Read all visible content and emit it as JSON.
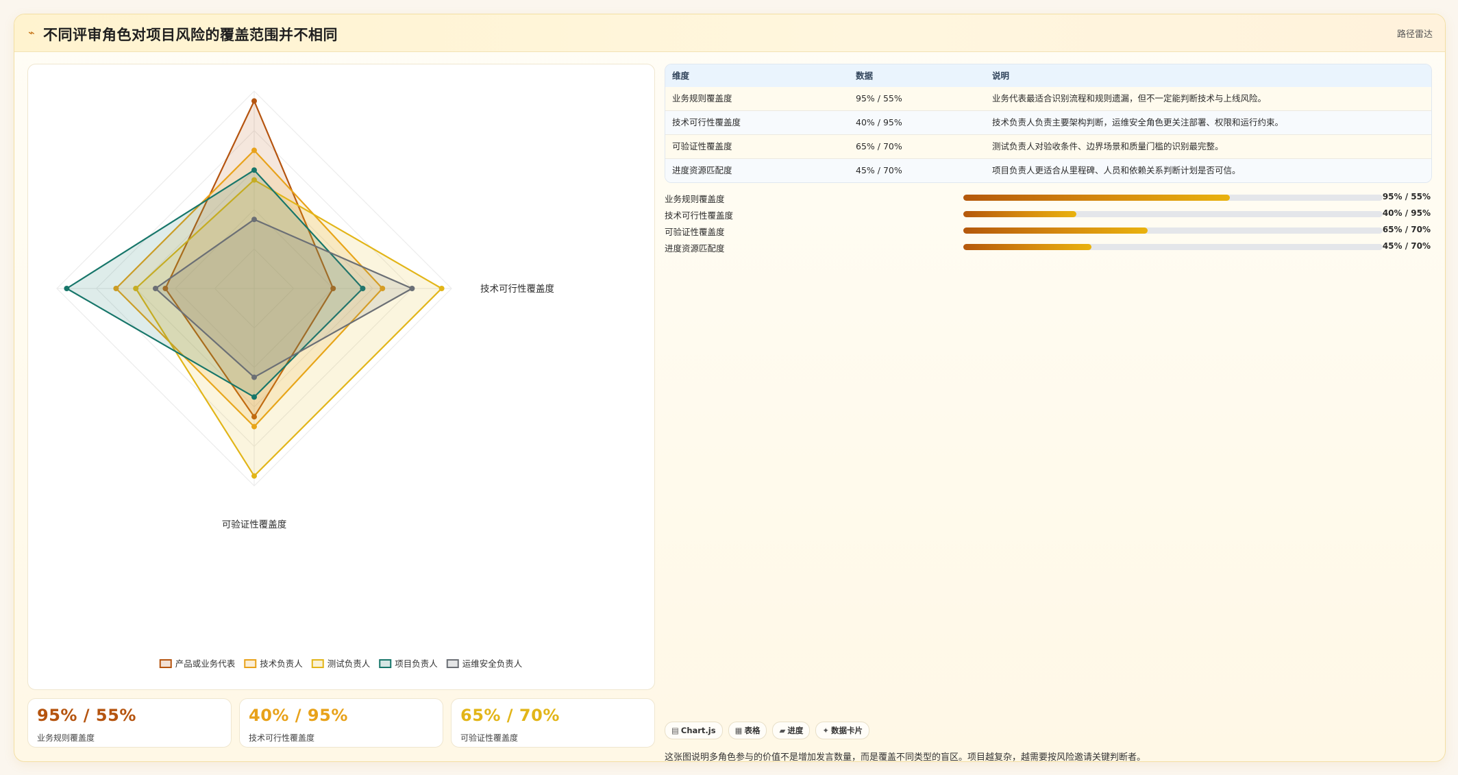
{
  "header": {
    "title": "不同评审角色对项目风险的覆盖范围并不相同",
    "tag": "路径雷达"
  },
  "chart_data": {
    "type": "radar",
    "axes": [
      "业务规则覆盖度",
      "技术可行性覆盖度",
      "可验证性覆盖度",
      "进度资源匹配度"
    ],
    "rmax": 100,
    "grid": true,
    "legend_position": "bottom",
    "series": [
      {
        "name": "产品或业务代表",
        "color": "#b5540f",
        "values": [
          95,
          40,
          65,
          45
        ]
      },
      {
        "name": "技术负责人",
        "color": "#e8a21a",
        "values": [
          70,
          65,
          70,
          70
        ]
      },
      {
        "name": "测试负责人",
        "color": "#e2b518",
        "values": [
          55,
          95,
          95,
          60
        ]
      },
      {
        "name": "项目负责人",
        "color": "#17766a",
        "values": [
          60,
          55,
          55,
          95
        ]
      },
      {
        "name": "运维安全负责人",
        "color": "#6b6f75",
        "values": [
          35,
          80,
          45,
          50
        ]
      }
    ]
  },
  "table": {
    "headers": [
      "维度",
      "数据",
      "说明"
    ],
    "rows": [
      [
        "业务规则覆盖度",
        "95% / 55%",
        "业务代表最适合识别流程和规则遗漏，但不一定能判断技术与上线风险。"
      ],
      [
        "技术可行性覆盖度",
        "40% / 95%",
        "技术负责人负责主要架构判断，运维安全角色更关注部署、权限和运行约束。"
      ],
      [
        "可验证性覆盖度",
        "65% / 70%",
        "测试负责人对验收条件、边界场景和质量门槛的识别最完整。"
      ],
      [
        "进度资源匹配度",
        "45% / 70%",
        "项目负责人更适合从里程碑、人员和依赖关系判断计划是否可信。"
      ]
    ]
  },
  "progress": [
    {
      "label": "业务规则覆盖度",
      "value_text": "95% / 55%",
      "fill": 0.635
    },
    {
      "label": "技术可行性覆盖度",
      "value_text": "40% / 95%",
      "fill": 0.27
    },
    {
      "label": "可验证性覆盖度",
      "value_text": "65% / 70%",
      "fill": 0.44
    },
    {
      "label": "进度资源匹配度",
      "value_text": "45% / 70%",
      "fill": 0.305
    }
  ],
  "kpis": [
    {
      "value": "95% / 55%",
      "label": "业务规则覆盖度",
      "color": "#b5540f"
    },
    {
      "value": "40% / 95%",
      "label": "技术可行性覆盖度",
      "color": "#e8a21a"
    },
    {
      "value": "65% / 70%",
      "label": "可验证性覆盖度",
      "color": "#e2b518"
    }
  ],
  "chips": [
    {
      "icon": "▤",
      "icon_name": "chart-icon",
      "label": "Chart.js"
    },
    {
      "icon": "▦",
      "icon_name": "table-icon",
      "label": "表格"
    },
    {
      "icon": "▰",
      "icon_name": "progress-icon",
      "label": "进度"
    },
    {
      "icon": "✦",
      "icon_name": "card-icon",
      "label": "数据卡片"
    }
  ],
  "note": "这张图说明多角色参与的价值不是增加发言数量，而是覆盖不同类型的盲区。项目越复杂，越需要按风险邀请关键判断者。"
}
